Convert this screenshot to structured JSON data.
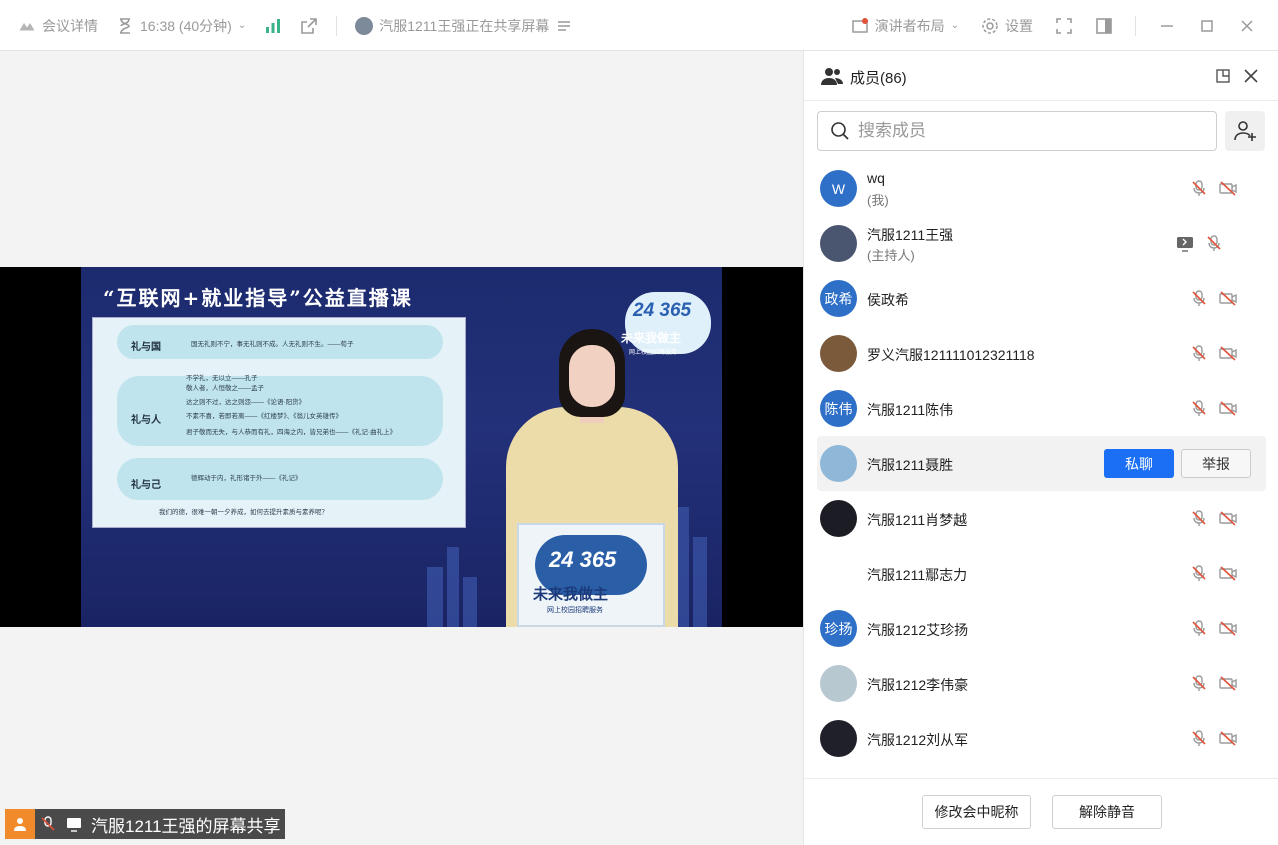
{
  "topbar": {
    "meeting_details": "会议详情",
    "timer": "16:38 (40分钟)",
    "sharer_status": "汽服1211王强正在共享屏幕",
    "layout_label": "演讲者布局",
    "settings_label": "设置"
  },
  "slide": {
    "title": "“互联网+就业指导”公益直播课",
    "rows": [
      {
        "label": "礼与国",
        "text": "国无礼则不宁，事无礼则不成。人无礼则不生。——荀子"
      },
      {
        "label": "礼与人",
        "lines": [
          "不学礼，无以立——孔子",
          "敬人者，人恒敬之——孟子",
          "达之则不过，达之则怨——《论语·阳货》",
          "不素不喜，若即若离——《红楼梦》、《翁儿女英雄传》",
          "君子敬而无失，与人恭而有礼，四海之内，皆兄弟也——《礼记·曲礼上》"
        ]
      },
      {
        "label": "礼与己",
        "text": "德辉动于内，礼形诸于外——《礼记》"
      }
    ],
    "footer": "我们的德，很难一朝一夕养成，如何去提升素质与素养呢？",
    "logo_num": "24 365",
    "logo_text": "未来我做主",
    "logo_sub": "网上校园招聘服务"
  },
  "share_tag": {
    "label": "汽服1211王强的屏幕共享"
  },
  "panel": {
    "title": "成员(86)",
    "search_placeholder": "搜索成员",
    "members": [
      {
        "name": "wq",
        "role": "(我)",
        "avatar_text": "W",
        "avatar_color": "#2e6fc7",
        "icons": [
          "mic-off-icon",
          "camera-off-icon"
        ]
      },
      {
        "name": "汽服1211王强",
        "role": "(主持人)",
        "avatar_text": "",
        "avatar_color": "#4a5670",
        "icons": [
          "screen-share-icon",
          "mic-off-icon"
        ]
      },
      {
        "name": "侯政希",
        "role": "",
        "avatar_text": "政希",
        "avatar_color": "#2e6fc7",
        "icons": [
          "mic-off-icon",
          "camera-off-icon"
        ]
      },
      {
        "name": "罗义汽服121111012321118",
        "role": "",
        "avatar_text": "",
        "avatar_color": "#7a5a3a",
        "icons": [
          "mic-off-icon",
          "camera-off-icon"
        ]
      },
      {
        "name": "汽服1211陈伟",
        "role": "",
        "avatar_text": "陈伟",
        "avatar_color": "#2e6fc7",
        "icons": [
          "mic-off-icon",
          "camera-off-icon"
        ]
      },
      {
        "name": "汽服1211聂胜",
        "role": "",
        "avatar_text": "",
        "avatar_color": "#8fb8d8",
        "icons": []
      },
      {
        "name": "汽服1211肖梦越",
        "role": "",
        "avatar_text": "",
        "avatar_color": "#1c1c24",
        "icons": [
          "mic-off-icon",
          "camera-off-icon"
        ]
      },
      {
        "name": "汽服1211鄢志力",
        "role": "",
        "avatar_text": "",
        "avatar_color": "#ffffff",
        "icons": [
          "mic-off-icon",
          "camera-off-icon"
        ]
      },
      {
        "name": "汽服1212艾珍扬",
        "role": "",
        "avatar_text": "珍扬",
        "avatar_color": "#2e6fc7",
        "icons": [
          "mic-off-icon",
          "camera-off-icon"
        ]
      },
      {
        "name": "汽服1212李伟豪",
        "role": "",
        "avatar_text": "",
        "avatar_color": "#b8c8d0",
        "icons": [
          "mic-off-icon",
          "camera-off-icon"
        ]
      },
      {
        "name": "汽服1212刘从军",
        "role": "",
        "avatar_text": "",
        "avatar_color": "#20202a",
        "icons": [
          "mic-off-icon",
          "camera-off-icon"
        ]
      }
    ],
    "hover_actions": {
      "chat": "私聊",
      "report": "举报"
    },
    "footer": {
      "rename": "修改会中昵称",
      "unmute": "解除静音"
    }
  },
  "colors": {
    "accent": "#1a6ff5",
    "muted_red": "#e0523a",
    "share_badge": "#f08a2a"
  }
}
